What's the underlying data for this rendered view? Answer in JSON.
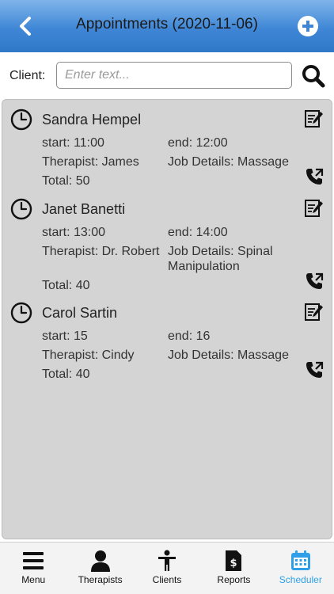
{
  "header": {
    "title": "Appointments (2020-11-06)",
    "back_icon": "chevron-left-icon",
    "add_icon": "plus-circle-icon"
  },
  "search": {
    "label": "Client:",
    "placeholder": "Enter text...",
    "value": "",
    "icon": "search-icon"
  },
  "appointments": [
    {
      "name": "Sandra Hempel",
      "start": "start: 11:00",
      "end": "end: 12:00",
      "therapist": "Therapist: James",
      "job": "Job Details: Massage",
      "total": "Total: 50"
    },
    {
      "name": "Janet Banetti",
      "start": "start: 13:00",
      "end": "end: 14:00",
      "therapist": "Therapist: Dr. Robert",
      "job": "Job Details: Spinal Manipulation",
      "total": "Total: 40"
    },
    {
      "name": "Carol Sartin",
      "start": "start: 15",
      "end": "end: 16",
      "therapist": "Therapist: Cindy",
      "job": "Job Details: Massage",
      "total": "Total: 40"
    }
  ],
  "nav": {
    "items": [
      {
        "label": "Menu",
        "icon": "hamburger-menu-icon",
        "active": false
      },
      {
        "label": "Therapists",
        "icon": "person-icon",
        "active": false
      },
      {
        "label": "Clients",
        "icon": "standing-person-icon",
        "active": false
      },
      {
        "label": "Reports",
        "icon": "dollar-document-icon",
        "active": false
      },
      {
        "label": "Scheduler",
        "icon": "calendar-icon",
        "active": true
      }
    ]
  },
  "colors": {
    "header_top": "#7fb4ea",
    "header_bottom": "#2f78c8",
    "list_bg": "#d4d4d4",
    "active_nav": "#2fa0e8"
  }
}
